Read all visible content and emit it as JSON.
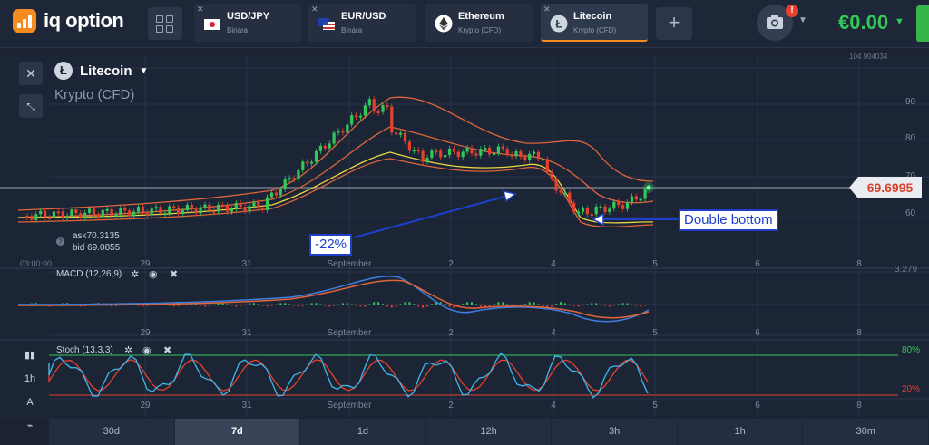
{
  "brand": {
    "name": "iq option"
  },
  "tabs": [
    {
      "name": "USD/JPY",
      "sub": "Binára",
      "icon": "japan-flag-icon",
      "active": false
    },
    {
      "name": "EUR/USD",
      "sub": "Binára",
      "icon": "eu-us-flag-icon",
      "active": false
    },
    {
      "name": "Ethereum",
      "sub": "Krypto (CFD)",
      "icon": "ethereum-icon",
      "active": false
    },
    {
      "name": "Litecoin",
      "sub": "Krypto (CFD)",
      "icon": "litecoin-icon",
      "active": true
    }
  ],
  "header": {
    "balance": "€0.00",
    "notification_badge": "!",
    "add_tab": "+"
  },
  "asset": {
    "name": "Litecoin",
    "subtitle": "Krypto (CFD)",
    "icon_letter": "Ł",
    "price": "69.6995",
    "ask_label": "ask",
    "ask": "70.3135",
    "bid_label": "bid",
    "bid": "69.0855"
  },
  "price_axis": {
    "labels": [
      "90",
      "80",
      "70",
      "60"
    ],
    "top_label": "104.904034"
  },
  "time_axis": {
    "labels": [
      "29",
      "31",
      "September",
      "2",
      "4",
      "5",
      "6",
      "8"
    ],
    "start_label": "03:00:00"
  },
  "annotations": {
    "percent": "-22%",
    "pattern": "Double bottom"
  },
  "macd": {
    "label": "MACD (12,26,9)",
    "right_label": "3.279"
  },
  "stoch": {
    "label": "Stoch (13,3,3)",
    "upper": "80%",
    "lower": "20%",
    "upper_color": "#34c759",
    "lower_color": "#e5412d"
  },
  "left_tools": {
    "interval": "1h"
  },
  "timeframes": [
    {
      "label": "30d",
      "active": false
    },
    {
      "label": "7d",
      "active": true
    },
    {
      "label": "1d",
      "active": false
    },
    {
      "label": "12h",
      "active": false
    },
    {
      "label": "3h",
      "active": false
    },
    {
      "label": "1h",
      "active": false
    },
    {
      "label": "30m",
      "active": false
    }
  ],
  "colors": {
    "bollinger": "#e0653a",
    "ma": "#e8d444",
    "candle_up": "#34c759",
    "candle_down": "#e5412d",
    "macd": "#3d7fe0",
    "signal": "#e0653a",
    "accent": "#f68b1f"
  }
}
